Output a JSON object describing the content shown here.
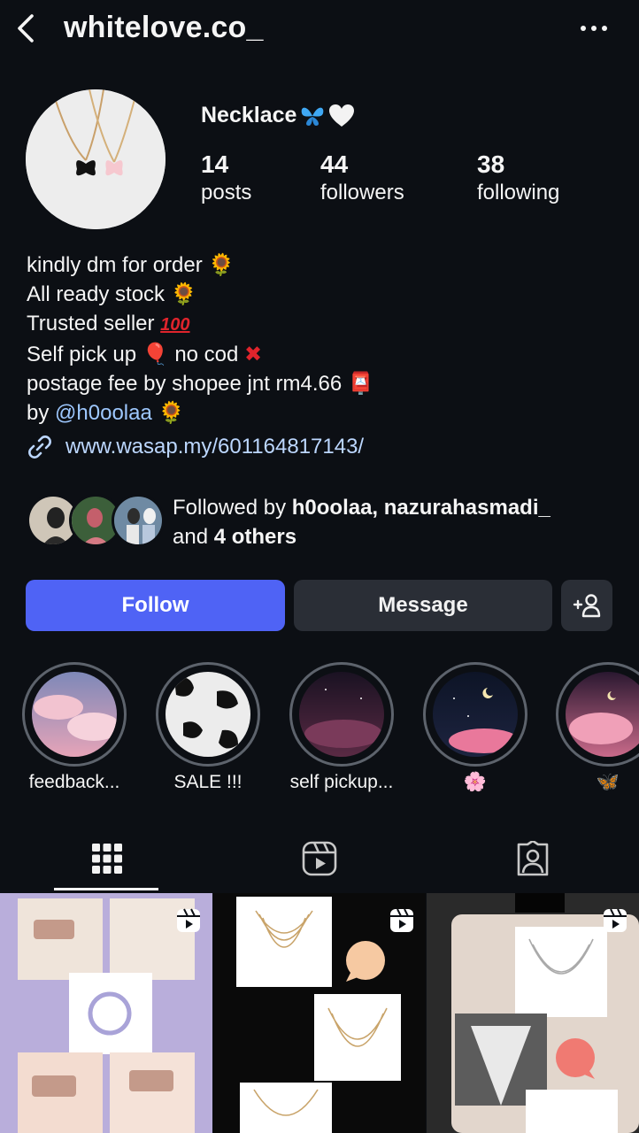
{
  "header": {
    "username": "whitelove.co_"
  },
  "profile": {
    "display_name": "Necklace",
    "stats": [
      {
        "value": "14",
        "label": "posts"
      },
      {
        "value": "44",
        "label": "followers"
      },
      {
        "value": "38",
        "label": "following"
      }
    ],
    "bio": {
      "line1": "kindly dm for order",
      "line2": "All ready stock",
      "line3": "Trusted seller",
      "line4a": "Self pick up",
      "line4b": "no cod",
      "line5": "postage fee by shopee jnt rm4.66",
      "line6_prefix": "by",
      "line6_mention": "@h0oolaa"
    },
    "link": "www.wasap.my/601164817143/",
    "followed_by": {
      "prefix": "Followed by",
      "names": "h0oolaa, nazurahasmadi_",
      "and": "and",
      "others": "4 others"
    }
  },
  "actions": {
    "follow": "Follow",
    "message": "Message"
  },
  "highlights": [
    {
      "label": "feedback..."
    },
    {
      "label": "SALE !!!"
    },
    {
      "label": "self pickup..."
    },
    {
      "label": "🌸"
    },
    {
      "label": "🦋"
    }
  ],
  "colors": {
    "background": "#0c0f14",
    "follow_button": "#4f63f5",
    "secondary_button": "#2a2e36",
    "link": "#bcd7ff",
    "mention": "#9ec8ff"
  }
}
